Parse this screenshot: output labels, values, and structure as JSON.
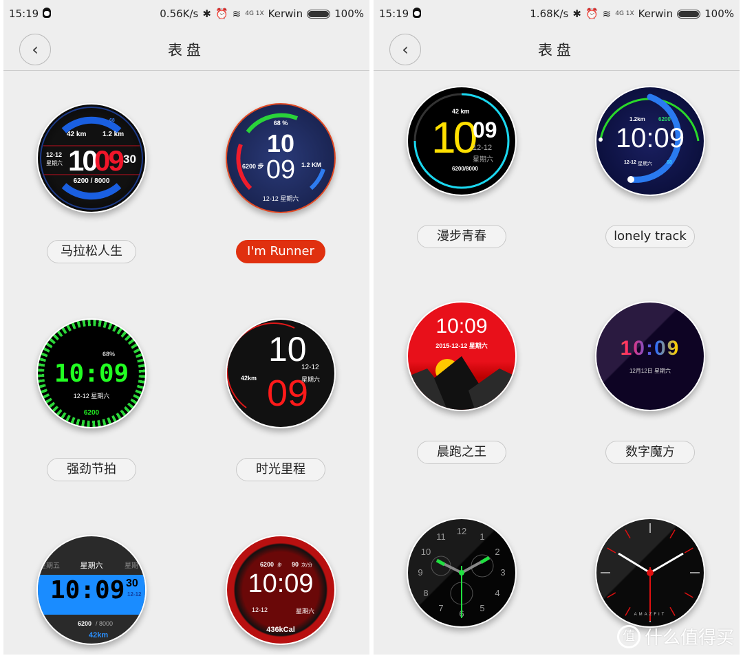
{
  "left": {
    "status": {
      "time": "15:19",
      "speed": "0.56K/s",
      "carrier": "Kerwin",
      "battery": "100%",
      "network": "4G 1X"
    },
    "header": {
      "title": "表盘",
      "back_icon": "chevron-left"
    },
    "faces": [
      {
        "label": "马拉松人生",
        "selected": false,
        "distance": "42 km",
        "run": "1.2 km",
        "date": "12-12",
        "weekday": "星期六",
        "hour": "10",
        "minute": "09",
        "second": "30",
        "steps": "6200 / 8000",
        "battery": "68"
      },
      {
        "label": "I'm Runner",
        "selected": true,
        "battery": "68 %",
        "hour": "10",
        "minute": "09",
        "steps": "6200 步",
        "run": "1.2 KM",
        "date": "12-12 星期六"
      },
      {
        "label": "强劲节拍",
        "selected": false,
        "battery": "68%",
        "time": "10:09",
        "date": "12-12  星期六",
        "steps": "6200"
      },
      {
        "label": "时光里程",
        "selected": false,
        "hour": "10",
        "minute": "09",
        "distance": "42km",
        "date": "12-12",
        "weekday": "星期六"
      },
      {
        "label": "",
        "prev_day": "星期五",
        "weekday": "星期六",
        "next_day": "星期",
        "time": "10:09",
        "second": "30",
        "date": "12-12",
        "steps": "6200",
        "steps_goal": "/ 8000",
        "distance": "42km"
      },
      {
        "label": "",
        "steps": "6200",
        "steps_unit": "步",
        "heart": "90",
        "heart_unit": "次/分",
        "time": "10:09",
        "date": "12-12",
        "weekday": "星期六",
        "calories": "436kCal"
      }
    ]
  },
  "right": {
    "status": {
      "time": "15:19",
      "speed": "1.68K/s",
      "carrier": "Kerwin",
      "battery": "100%",
      "network": "4G 1X"
    },
    "header": {
      "title": "表盘",
      "back_icon": "chevron-left"
    },
    "faces": [
      {
        "label": "漫步青春",
        "distance": "42 km",
        "hour": "10",
        "minute": "09",
        "date": "12-12",
        "weekday": "星期六",
        "steps": "6200/8000"
      },
      {
        "label": "lonely track",
        "run": "1.2km",
        "steps": "6200",
        "time": "10:09",
        "date": "12-12",
        "weekday": "星期六",
        "battery": "68"
      },
      {
        "label": "晨跑之王",
        "time": "10:09",
        "date": "2015-12-12  星期六"
      },
      {
        "label": "数字魔方",
        "time": "10:09",
        "date": "12月12日 星期六"
      },
      {
        "label": "",
        "numerals": [
          "12",
          "1",
          "2",
          "3",
          "4",
          "5",
          "6",
          "7",
          "8",
          "9",
          "10",
          "11"
        ]
      },
      {
        "label": "",
        "brand": "AMAZFIT"
      }
    ]
  },
  "watermark": {
    "icon": "值",
    "text": "什么值得买"
  },
  "colors": {
    "accent": "#e0300f",
    "background": "#eeeeee"
  }
}
